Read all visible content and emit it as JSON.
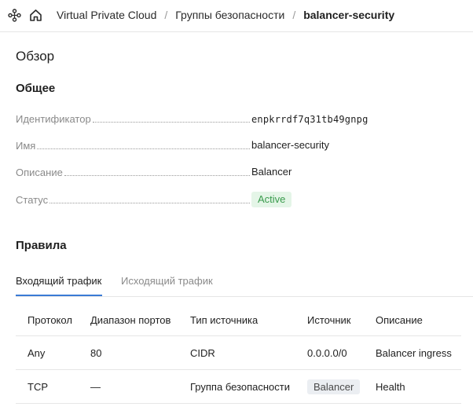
{
  "breadcrumb": {
    "service": "Virtual Private Cloud",
    "section": "Группы безопасности",
    "current": "balancer-security",
    "separator": "/"
  },
  "overview": {
    "title": "Обзор",
    "general_title": "Общее",
    "fields": {
      "id_label": "Идентификатор",
      "id_value": "enpkrrdf7q31tb49gnpg",
      "name_label": "Имя",
      "name_value": "balancer-security",
      "description_label": "Описание",
      "description_value": "Balancer",
      "status_label": "Статус",
      "status_value": "Active"
    }
  },
  "rules": {
    "title": "Правила",
    "tabs": [
      "Входящий трафик",
      "Исходящий трафик"
    ],
    "active_tab": 0,
    "columns": [
      "Протокол",
      "Диапазон портов",
      "Тип источника",
      "Источник",
      "Описание"
    ],
    "rows": [
      {
        "protocol": "Any",
        "ports": "80",
        "source_type": "CIDR",
        "source": "0.0.0.0/0",
        "description": "Balancer ingress"
      },
      {
        "protocol": "TCP",
        "ports": "—",
        "source_type": "Группа безопасности",
        "source": "Balancer",
        "description": "Health"
      }
    ]
  },
  "colors": {
    "accent": "#3a7bd5",
    "status_active_bg": "#e4f5e7",
    "status_active_text": "#3a9b4d"
  }
}
